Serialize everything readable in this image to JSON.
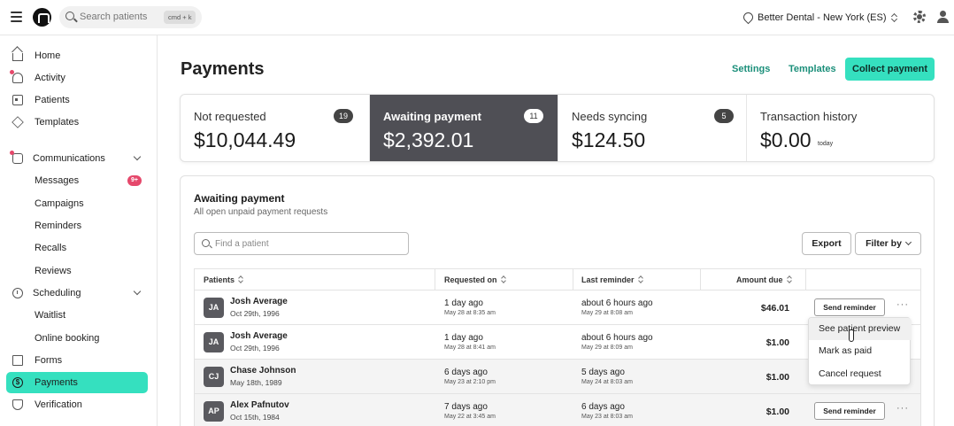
{
  "topbar": {
    "search_placeholder": "Search patients",
    "search_shortcut": "cmd + k",
    "location": "Better Dental - New York (ES)"
  },
  "sidebar": {
    "items": [
      {
        "label": "Home",
        "icon": "home-icon"
      },
      {
        "label": "Activity",
        "icon": "bell-icon"
      },
      {
        "label": "Patients",
        "icon": "id-card-icon"
      },
      {
        "label": "Templates",
        "icon": "box-icon"
      },
      {
        "label": "Communications",
        "icon": "chat-icon"
      },
      {
        "label": "Messages",
        "badge": "9+"
      },
      {
        "label": "Campaigns"
      },
      {
        "label": "Reminders"
      },
      {
        "label": "Recalls"
      },
      {
        "label": "Reviews"
      },
      {
        "label": "Scheduling",
        "icon": "clock-icon"
      },
      {
        "label": "Waitlist"
      },
      {
        "label": "Online booking"
      },
      {
        "label": "Forms",
        "icon": "document-icon"
      },
      {
        "label": "Payments",
        "icon": "dollar-icon",
        "active": true
      },
      {
        "label": "Verification",
        "icon": "shield-icon"
      }
    ]
  },
  "page": {
    "title": "Payments",
    "settings_label": "Settings",
    "templates_label": "Templates",
    "collect_label": "Collect payment"
  },
  "stats": [
    {
      "label": "Not requested",
      "value": "$10,044.49",
      "count": "19"
    },
    {
      "label": "Awaiting payment",
      "value": "$2,392.01",
      "count": "11",
      "selected": true
    },
    {
      "label": "Needs syncing",
      "value": "$124.50",
      "count": "5"
    },
    {
      "label": "Transaction history",
      "value": "$0.00",
      "suffix": "today"
    }
  ],
  "panel": {
    "title": "Awaiting payment",
    "subtitle": "All open unpaid payment requests",
    "find_placeholder": "Find a patient",
    "export_label": "Export",
    "filter_label": "Filter by"
  },
  "table": {
    "headers": [
      "Patients",
      "Requested on",
      "Last reminder",
      "Amount due"
    ],
    "rows": [
      {
        "initials": "JA",
        "name": "Josh Average",
        "dob": "Oct 29th, 1996",
        "requested": "1 day ago",
        "requested_at": "May 28 at 8:35 am",
        "reminder": "about 6 hours ago",
        "reminder_at": "May 29 at 8:08 am",
        "amount": "$46.01",
        "action": "Send reminder"
      },
      {
        "initials": "JA",
        "name": "Josh Average",
        "dob": "Oct 29th, 1996",
        "requested": "1 day ago",
        "requested_at": "May 28 at 8:41 am",
        "reminder": "about 6 hours ago",
        "reminder_at": "May 29 at 8:09 am",
        "amount": "$1.00"
      },
      {
        "initials": "CJ",
        "name": "Chase Johnson",
        "dob": "May 18th, 1989",
        "requested": "6 days ago",
        "requested_at": "May 23 at 2:10 pm",
        "reminder": "5 days ago",
        "reminder_at": "May 24 at 8:03 am",
        "amount": "$1.00"
      },
      {
        "initials": "AP",
        "name": "Alex Pafnutov",
        "dob": "Oct 15th, 1984",
        "requested": "7 days ago",
        "requested_at": "May 22 at 3:45 am",
        "reminder": "6 days ago",
        "reminder_at": "May 23 at 8:03 am",
        "amount": "$1.00",
        "action": "Send reminder"
      }
    ]
  },
  "context_menu": [
    "See patient preview",
    "Mark as paid",
    "Cancel request"
  ]
}
